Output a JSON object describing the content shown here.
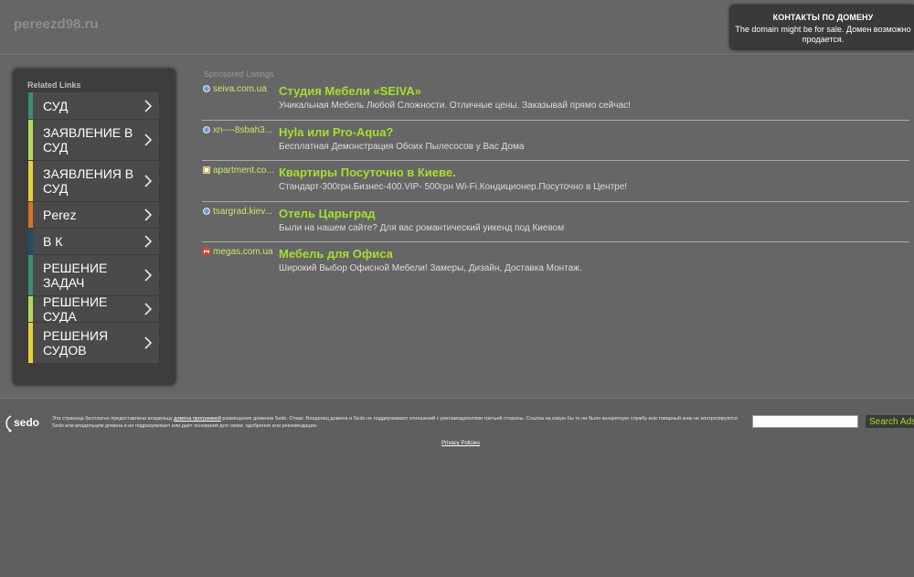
{
  "header": {
    "site_name": "pereezd98.ru",
    "contact_title": "КОНТАКТЫ ПО ДОМЕНУ",
    "contact_text": "The domain might be for sale. Домен возможно продается."
  },
  "related": {
    "title": "Related Links",
    "items": [
      {
        "label": "СУД",
        "color": "#3c8c78"
      },
      {
        "label": "ЗАЯВЛЕНИЕ В СУД",
        "color": "#b8d65a"
      },
      {
        "label": "ЗАЯВЛЕНИЯ В СУД",
        "color": "#e6cf3a"
      },
      {
        "label": "Perez",
        "color": "#d9712a"
      },
      {
        "label": "В К",
        "color": "#1f4f6b"
      },
      {
        "label": "РЕШЕНИЕ ЗАДАЧ",
        "color": "#3c8c78"
      },
      {
        "label": "РЕШЕНИЕ СУДА",
        "color": "#b8d65a"
      },
      {
        "label": "РЕШЕНИЯ СУДОВ",
        "color": "#e6cf3a"
      }
    ]
  },
  "sponsored": {
    "title": "Sponsored Listings",
    "items": [
      {
        "domain": "seiva.com.ua",
        "title": "Студия Мебели «SEIVA»",
        "desc": "Уникальная Мебель Любой Сложности. Отличные цены. Заказывай прямо сейчас!",
        "icon": "globe-icon"
      },
      {
        "domain": "xn----8sbah3...",
        "title": "Hyla или Pro-Aqua?",
        "desc": "Бесплатная Демонстрация Обоих Пылесосов у Вас Дома",
        "icon": "globe-icon"
      },
      {
        "domain": "apartment.co...",
        "title": "Квартиры Посуточно в Киеве.",
        "desc": "Стандарт-300грн.Бизнес-400.VIP- 500грн Wi-Fi.Кондиционер.Посуточно в Центре!",
        "icon": "site-favicon-icon"
      },
      {
        "domain": "tsargrad.kiev...",
        "title": "Отель Царьград",
        "desc": "Были на нашем сайте? Для вас романтический уикенд под Киевом",
        "icon": "globe-icon"
      },
      {
        "domain": "megas.com.ua",
        "title": "Мебель для Офиса",
        "desc": "Широкий Выбор Офисной Мебели! Замеры, Дизайн, Доставка Монтаж.",
        "icon": "megas-favicon-icon"
      }
    ]
  },
  "footer": {
    "logo_text": "sedo",
    "text_before_link": "Эта страница бесплатно предоставлена владельцу ",
    "link_text": "домена программой",
    "text_after_link": " размещения доменов Sedo. Отказ: Владелец домена и Sedo не поддерживают отношений с рекламодателями третьей стороны. Ссылка на какую бы то ни было конкретную службу или товарный знак не контролируется Sedo или владельцем домена и не подразумевает или дает основания для связи, одобрения или рекомендации.",
    "search_placeholder": "",
    "search_button": "Search Ads",
    "privacy": "Privacy Policies"
  },
  "colors": {
    "accent_green": "#a3e02e",
    "domain_green": "#c8e86b"
  }
}
